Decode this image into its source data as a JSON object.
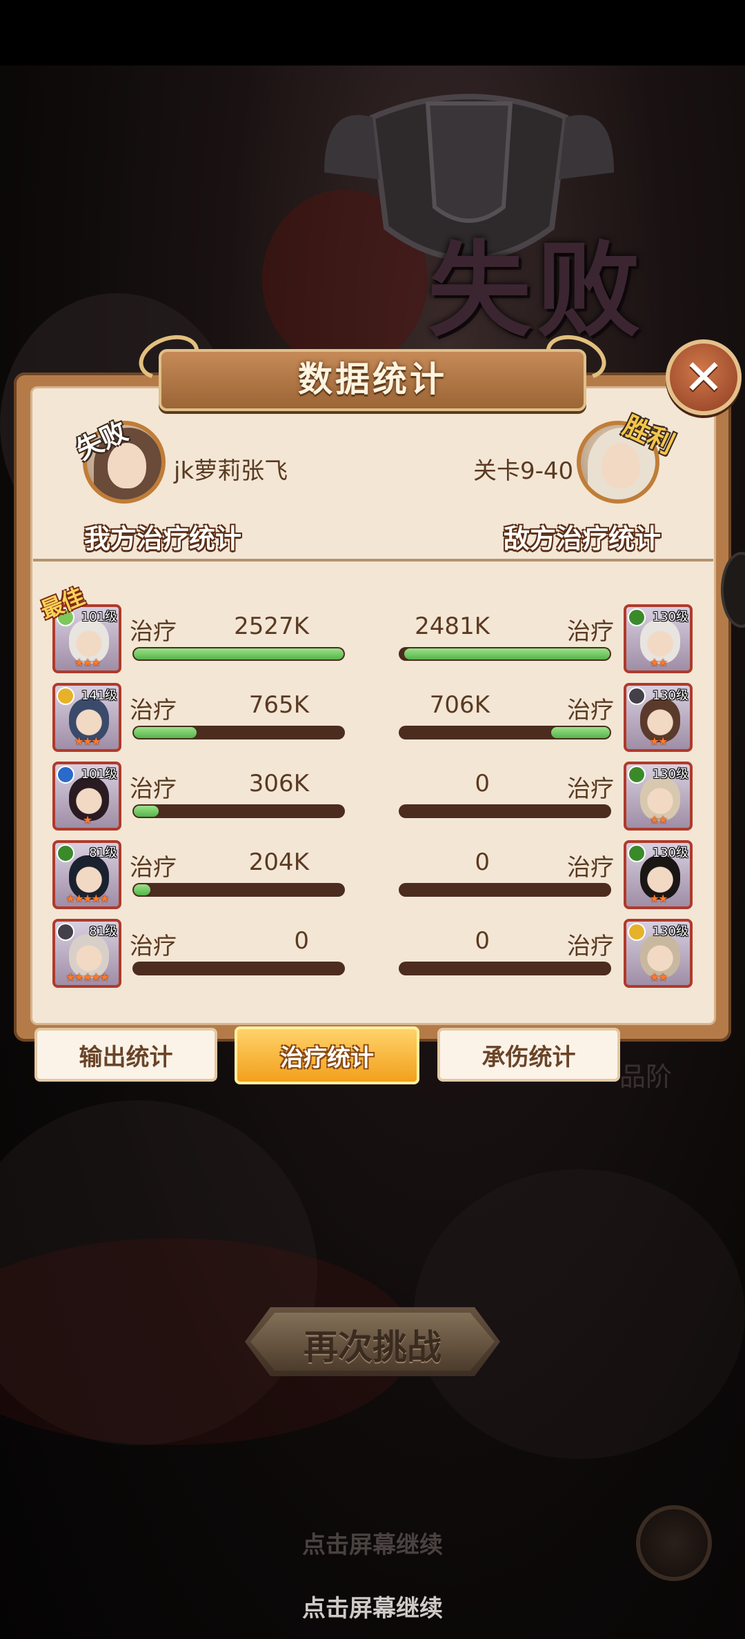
{
  "result": {
    "title": "失败"
  },
  "panel": {
    "title": "数据统计",
    "close_icon": "close-icon"
  },
  "header": {
    "player": {
      "name": "jk萝莉张飞",
      "stamp": "失败",
      "label": "我方治疗统计"
    },
    "enemy": {
      "name": "关卡9-40",
      "stamp": "胜利",
      "label": "敌方治疗统计"
    }
  },
  "best_tag": "最佳",
  "stat_label": "治疗",
  "rows": [
    {
      "ally": {
        "level": "101级",
        "stars": "★★★",
        "element": "#7ec85a",
        "value": "2527K",
        "fill": 1.0
      },
      "enemy": {
        "level": "130级",
        "stars": "★★",
        "element": "#3a8a2a",
        "value": "2481K",
        "fill": 0.98
      }
    },
    {
      "ally": {
        "level": "141级",
        "stars": "★★★",
        "element": "#e6b22a",
        "value": "765K",
        "fill": 0.3
      },
      "enemy": {
        "level": "130级",
        "stars": "★★",
        "element": "#44404a",
        "value": "706K",
        "fill": 0.28
      }
    },
    {
      "ally": {
        "level": "101级",
        "stars": "★",
        "element": "#2a6ac8",
        "value": "306K",
        "fill": 0.12
      },
      "enemy": {
        "level": "130级",
        "stars": "★★",
        "element": "#3a8a2a",
        "value": "0",
        "fill": 0
      }
    },
    {
      "ally": {
        "level": "81级",
        "stars": "★★★★★",
        "element": "#3a8a2a",
        "value": "204K",
        "fill": 0.08
      },
      "enemy": {
        "level": "130级",
        "stars": "★★",
        "element": "#3a8a2a",
        "value": "0",
        "fill": 0
      }
    },
    {
      "ally": {
        "level": "81级",
        "stars": "★★★★★",
        "element": "#44404a",
        "value": "0",
        "fill": 0
      },
      "enemy": {
        "level": "130级",
        "stars": "★★",
        "element": "#e6b22a",
        "value": "0",
        "fill": 0
      }
    }
  ],
  "tabs": [
    {
      "label": "输出统计",
      "active": false
    },
    {
      "label": "治疗统计",
      "active": true
    },
    {
      "label": "承伤统计",
      "active": false
    }
  ],
  "grade_text": "品阶",
  "retry_label": "再次挑战",
  "tap_continue": "点击屏幕继续"
}
